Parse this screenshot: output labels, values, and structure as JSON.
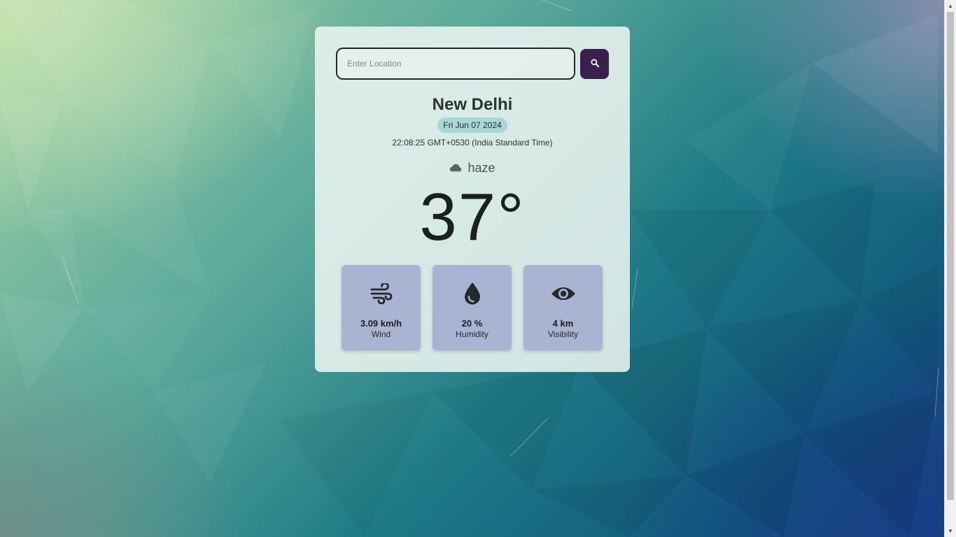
{
  "search": {
    "placeholder": "Enter Location",
    "button_icon": "search-icon"
  },
  "location": {
    "city": "New Delhi",
    "date": "Fri Jun 07 2024",
    "time": "22:08:25 GMT+0530 (India Standard Time)"
  },
  "weather": {
    "condition_icon": "cloud-icon",
    "condition": "haze",
    "temperature": "37°"
  },
  "stats": [
    {
      "icon": "wind-icon",
      "value": "3.09 km/h",
      "label": "Wind"
    },
    {
      "icon": "water-drop-icon",
      "value": "20 %",
      "label": "Humidity"
    },
    {
      "icon": "eye-icon",
      "value": "4 km",
      "label": "Visibility"
    }
  ],
  "colors": {
    "search_button": "#3b1f4c",
    "date_badge": "#a9d6d6",
    "stat_tile": "#aab3d2"
  }
}
